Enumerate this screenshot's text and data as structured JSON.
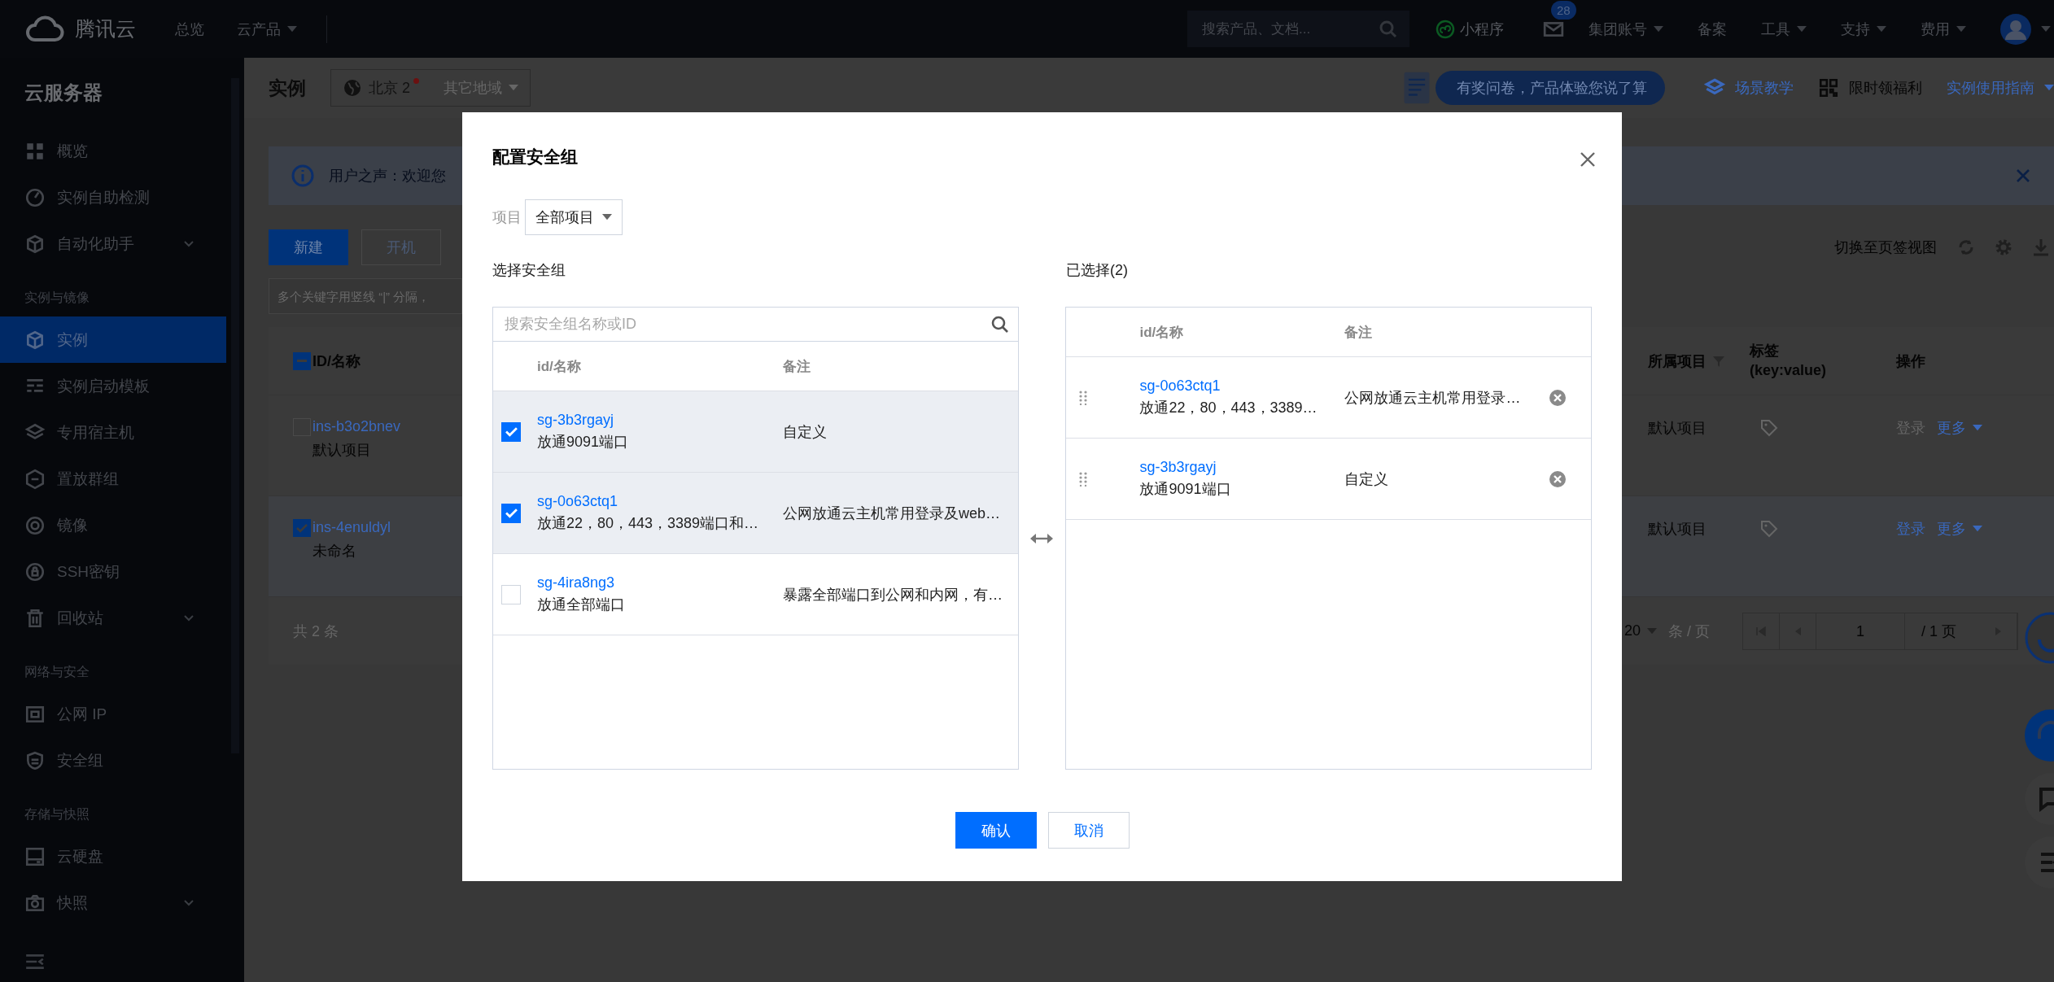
{
  "topbar": {
    "logo": "腾讯云",
    "nav": [
      {
        "label": "总览",
        "dropdown": false
      },
      {
        "label": "云产品",
        "dropdown": true
      }
    ],
    "search": {
      "placeholder": "搜索产品、文档..."
    },
    "mini_program": "小程序",
    "mail_badge": "28",
    "menu": [
      {
        "label": "集团账号",
        "dropdown": true
      },
      {
        "label": "备案",
        "dropdown": false
      },
      {
        "label": "工具",
        "dropdown": true
      },
      {
        "label": "支持",
        "dropdown": true
      },
      {
        "label": "费用",
        "dropdown": true
      }
    ]
  },
  "sidebar": {
    "title": "云服务器",
    "sections": [
      {
        "items": [
          {
            "label": "概览",
            "selected": false
          },
          {
            "label": "实例自助检测",
            "selected": false
          },
          {
            "label": "自动化助手",
            "selected": false,
            "expanded": false
          }
        ]
      },
      {
        "heading": "实例与镜像",
        "items": [
          {
            "label": "实例",
            "selected": true
          },
          {
            "label": "实例启动模板",
            "selected": false
          },
          {
            "label": "专用宿主机",
            "selected": false
          },
          {
            "label": "置放群组",
            "selected": false
          },
          {
            "label": "镜像",
            "selected": false
          },
          {
            "label": "SSH密钥",
            "selected": false
          },
          {
            "label": "回收站",
            "selected": false,
            "expanded": false
          }
        ]
      },
      {
        "heading": "网络与安全",
        "items": [
          {
            "label": "公网 IP",
            "selected": false
          },
          {
            "label": "安全组",
            "selected": false
          }
        ]
      },
      {
        "heading": "存储与快照",
        "items": [
          {
            "label": "云硬盘",
            "selected": false
          },
          {
            "label": "快照",
            "selected": false,
            "expanded": false
          }
        ]
      }
    ]
  },
  "page": {
    "title": "实例",
    "region": {
      "current": "北京 2",
      "alert": true,
      "other": "其它地域"
    },
    "survey": "有奖问卷，产品体验您说了算",
    "links": [
      {
        "label": "场景教学",
        "dropdown": false
      },
      {
        "label": "限时领福利",
        "dropdown": false
      },
      {
        "label": "实例使用指南",
        "dropdown": true
      }
    ],
    "notice": "用户之声：欢迎您",
    "toolbar": {
      "buttons": [
        {
          "label": "新建",
          "primary": true
        },
        {
          "label": "开机",
          "primary": false
        }
      ],
      "view_switch": "切换至页签视图"
    },
    "filter": {
      "placeholder": "多个关键字用竖线 “|” 分隔，"
    },
    "table": {
      "indeterminate": true,
      "columns": [
        "ID/名称",
        "所属项目",
        "标签 (key:value)",
        "操作"
      ],
      "rows": [
        {
          "id": "ins-b3o2bnev",
          "name": "默认项目",
          "checked": false,
          "project": "默认项目",
          "login": "登录",
          "login_disabled": true,
          "more": "更多"
        },
        {
          "id": "ins-4enuldyl",
          "name": "未命名",
          "checked": true,
          "project": "默认项目",
          "login": "登录",
          "login_disabled": false,
          "more": "更多"
        }
      ]
    },
    "footer": {
      "total": "共 2 条",
      "page_size": "20",
      "page_size_unit": "条 / 页",
      "page": "1",
      "pages": "/ 1 页"
    }
  },
  "modal": {
    "title": "配置安全组",
    "project": {
      "label": "项目",
      "value": "全部项目"
    },
    "available": {
      "heading": "选择安全组",
      "search_placeholder": "搜索安全组名称或ID",
      "columns": [
        "id/名称",
        "备注"
      ],
      "rows": [
        {
          "id": "sg-3b3rgayj",
          "desc": "放通9091端口",
          "note": "自定义",
          "checked": true
        },
        {
          "id": "sg-0o63ctq1",
          "desc": "放通22，80，443，3389端口和…",
          "note": "公网放通云主机常用登录及web…",
          "checked": true
        },
        {
          "id": "sg-4ira8ng3",
          "desc": "放通全部端口",
          "note": "暴露全部端口到公网和内网，有…",
          "checked": false
        }
      ]
    },
    "chosen": {
      "heading": "已选择(2)",
      "columns": [
        "id/名称",
        "备注"
      ],
      "rows": [
        {
          "id": "sg-0o63ctq1",
          "desc": "放通22，80，443，3389…",
          "note": "公网放通云主机常用登录…"
        },
        {
          "id": "sg-3b3rgayj",
          "desc": "放通9091端口",
          "note": "自定义"
        }
      ]
    },
    "confirm": "确认",
    "cancel": "取消"
  }
}
